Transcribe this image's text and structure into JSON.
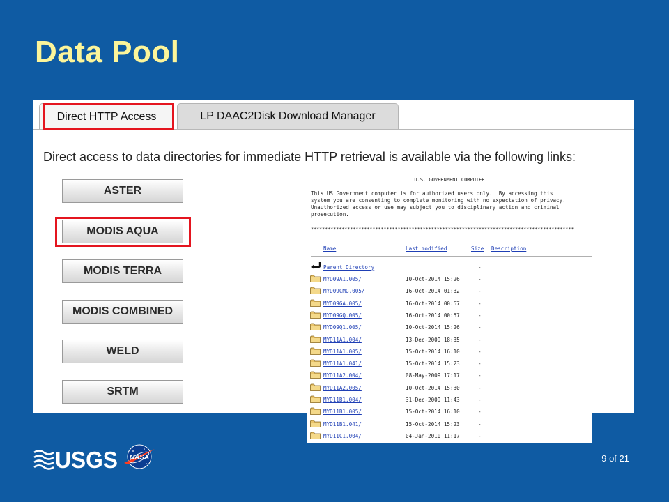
{
  "slide": {
    "title": "Data Pool",
    "page_number": "9 of 21"
  },
  "colors": {
    "background": "#0f5ba3",
    "title": "#fcf59a",
    "highlight": "#e4151f"
  },
  "tabs": [
    {
      "label": "Direct HTTP Access",
      "active": true
    },
    {
      "label": "LP DAAC2Disk Download Manager",
      "active": false
    }
  ],
  "intro_text": "Direct access to data directories for immediate HTTP retrieval is available via the following links:",
  "buttons": [
    {
      "label": "ASTER"
    },
    {
      "label": "MODIS AQUA"
    },
    {
      "label": "MODIS TERRA"
    },
    {
      "label": "MODIS COMBINED"
    },
    {
      "label": "WELD"
    },
    {
      "label": "SRTM"
    }
  ],
  "directory": {
    "notice_title": "U.S. GOVERNMENT COMPUTER",
    "notice_lines": [
      "This US Government computer is for authorized users only.  By accessing this",
      "system you are consenting to complete monitoring with no expectation of privacy.",
      "Unauthorized access or use may subject you to disciplinary action and criminal",
      "prosecution."
    ],
    "separator": "**********************************************************************************************",
    "columns": {
      "name": "Name",
      "modified": "Last modified",
      "size": "Size",
      "description": "Description"
    },
    "parent": {
      "name": "Parent Directory",
      "size": "-"
    },
    "entries": [
      {
        "name": "MYD09A1.005/",
        "modified": "10-Oct-2014 15:26",
        "size": "-"
      },
      {
        "name": "MYD09CMG.005/",
        "modified": "16-Oct-2014 01:32",
        "size": "-"
      },
      {
        "name": "MYD09GA.005/",
        "modified": "16-Oct-2014 00:57",
        "size": "-"
      },
      {
        "name": "MYD09GQ.005/",
        "modified": "16-Oct-2014 00:57",
        "size": "-"
      },
      {
        "name": "MYD09Q1.005/",
        "modified": "10-Oct-2014 15:26",
        "size": "-"
      },
      {
        "name": "MYD11A1.004/",
        "modified": "13-Dec-2009 18:35",
        "size": "-"
      },
      {
        "name": "MYD11A1.005/",
        "modified": "15-Oct-2014 16:10",
        "size": "-"
      },
      {
        "name": "MYD11A1.041/",
        "modified": "15-Oct-2014 15:23",
        "size": "-"
      },
      {
        "name": "MYD11A2.004/",
        "modified": "08-May-2009 17:17",
        "size": "-"
      },
      {
        "name": "MYD11A2.005/",
        "modified": "10-Oct-2014 15:30",
        "size": "-"
      },
      {
        "name": "MYD11B1.004/",
        "modified": "31-Dec-2009 11:43",
        "size": "-"
      },
      {
        "name": "MYD11B1.005/",
        "modified": "15-Oct-2014 16:10",
        "size": "-"
      },
      {
        "name": "MYD11B1.041/",
        "modified": "15-Oct-2014 15:23",
        "size": "-"
      },
      {
        "name": "MYD11C1.004/",
        "modified": "04-Jan-2010 11:17",
        "size": "-"
      }
    ]
  },
  "logos": {
    "usgs": "USGS",
    "nasa": "NASA"
  }
}
